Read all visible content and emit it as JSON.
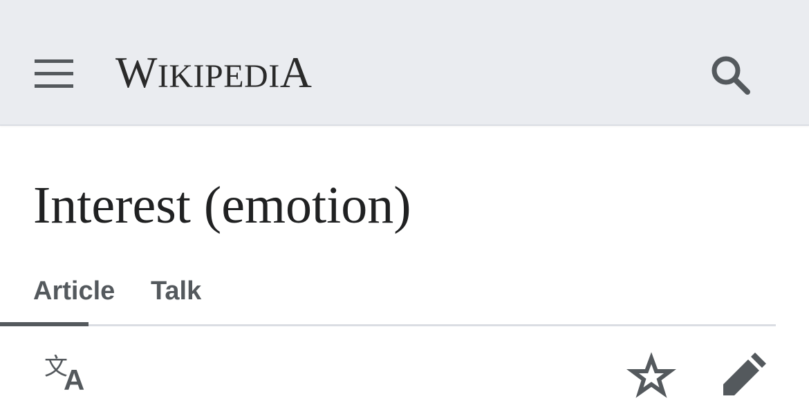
{
  "header": {
    "logo_text": "WIKIPEDIA",
    "logo_first": "W",
    "logo_middle": "IKIPEDI",
    "logo_last": "A",
    "background": "#eaecf0",
    "menu_icon": "hamburger-menu-icon",
    "search_icon": "search-icon"
  },
  "article": {
    "title": "Interest (emotion)"
  },
  "tabs": [
    {
      "label": "Article",
      "selected": true
    },
    {
      "label": "Talk",
      "selected": false
    }
  ],
  "actions": {
    "language_icon": "language-icon",
    "watch_icon": "star-icon",
    "edit_icon": "pencil-icon"
  },
  "colors": {
    "icon": "#54595d",
    "text": "#202122",
    "divider": "#dadde3"
  }
}
